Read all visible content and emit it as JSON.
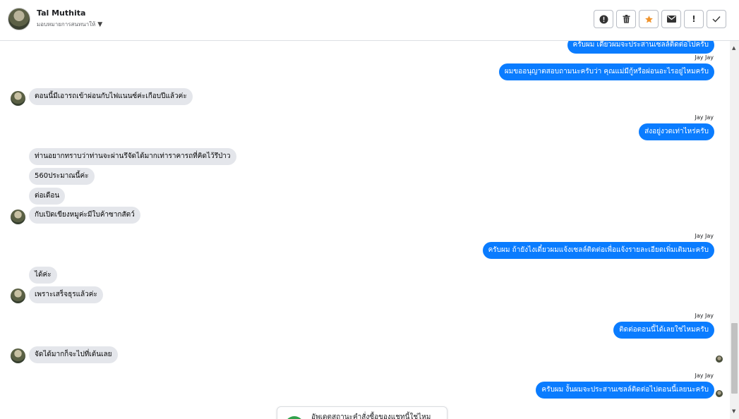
{
  "header": {
    "contact_name": "Tal Muthita",
    "assignee": "มอบหมายการสนทนาให้",
    "toolbar": [
      {
        "name": "info-button",
        "icon": "info-icon"
      },
      {
        "name": "delete-button",
        "icon": "trash-icon"
      },
      {
        "name": "star-button",
        "icon": "star-icon"
      },
      {
        "name": "mail-button",
        "icon": "envelope-icon"
      },
      {
        "name": "mark-important-button",
        "icon": "exclamation-icon"
      },
      {
        "name": "mark-done-button",
        "icon": "check-icon"
      }
    ]
  },
  "messages": [
    {
      "dir": "out",
      "text": "ครับผม เดี๋ยวผมจะประสานเซลล์ติดต่อไปครับ"
    },
    {
      "dir": "out",
      "sender": "Jay Jay",
      "text": "ผมขออนุญาตสอบถามนะครับว่า คุณแม่มีกู้หรือผ่อนอะไรอยู่ไหมครับ"
    },
    {
      "dir": "in",
      "text": "ตอนนี้มีเอารถเข้าผ่อนกับไฟแนนซ์ค่ะเกือบปีแล้วค่ะ"
    },
    {
      "dir": "out",
      "sender": "Jay Jay",
      "text": "ส่งอยู่งวดเท่าไหร่ครับ"
    },
    {
      "dir": "in",
      "text": "ท่านอยากทราบว่าท่านจะผ่านรึจัดได้มากเท่าราคารถที่คิดไว้รึป่าว"
    },
    {
      "dir": "in",
      "text": "560ประมาณนี้ค่ะ"
    },
    {
      "dir": "in",
      "text": "ต่อเดือน"
    },
    {
      "dir": "in",
      "text": "กับเปิดเขียงหมูค่ะมีใบค้าซากสัตว์"
    },
    {
      "dir": "out",
      "sender": "Jay Jay",
      "text": "ครับผม ถ้ายังไงเดี๋ยวผมแจ้งเซลล์ติดต่อเพื่อแจ้งรายละเอียดเพิ่มเติมนะครับ"
    },
    {
      "dir": "in",
      "text": "ได้ค่ะ"
    },
    {
      "dir": "in",
      "text": "เพราะเสร็จธุรแล้วค่ะ"
    },
    {
      "dir": "out",
      "sender": "Jay Jay",
      "text": "ติดต่อตอนนี้ได้เลยใช่ไหมครับ"
    },
    {
      "dir": "in",
      "text": "จัดได้มากก็จะไปที่เต้นเลย"
    },
    {
      "dir": "out",
      "sender": "Jay Jay",
      "text": "ครับผม งั้นผมจะประสานเซลล์ติดต่อไปตอนนี้เลยนะครับ"
    }
  ],
  "status_card": {
    "text": "อัพเดตสถานะคำสั่งซื้อของแชทนี้ใช่ไหม"
  },
  "colors": {
    "outgoing_bubble": "#0a7cff",
    "incoming_bubble": "#e4e6eb",
    "star": "#f0932b"
  }
}
